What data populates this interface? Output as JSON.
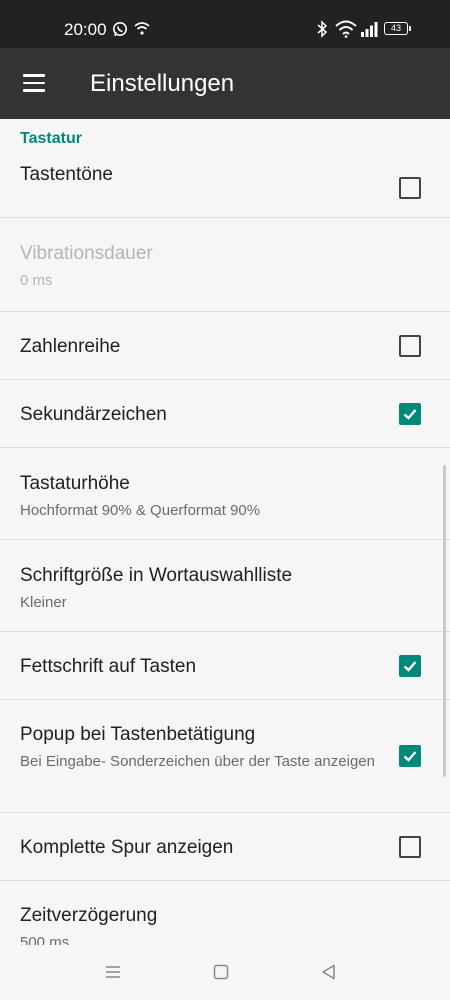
{
  "status_bar": {
    "time": "20:00",
    "battery": "43"
  },
  "app_bar": {
    "title": "Einstellungen"
  },
  "section": {
    "title": "Tastatur"
  },
  "prefs": [
    {
      "title": "Tastentöne",
      "checked": false
    },
    {
      "title": "Vibrationsdauer",
      "summary": "0 ms",
      "disabled": true
    },
    {
      "title": "Zahlenreihe",
      "checked": false
    },
    {
      "title": "Sekundärzeichen",
      "checked": true
    },
    {
      "title": "Tastaturhöhe",
      "summary": "Hochformat 90% & Querformat 90%"
    },
    {
      "title": "Schriftgröße in Wortauswahlliste",
      "summary": "Kleiner"
    },
    {
      "title": "Fettschrift auf Tasten",
      "checked": true
    },
    {
      "title": "Popup bei Tastenbetätigung",
      "summary": "Bei Eingabe- Sonderzeichen über der Taste anzeigen",
      "checked": true
    },
    {
      "title": "Komplette Spur anzeigen",
      "checked": false
    },
    {
      "title": "Zeitverzögerung",
      "summary": "500 ms"
    }
  ],
  "icons": {
    "menu": "hamburger-menu-icon",
    "checkbox_checked": "checkmark-icon",
    "nav_recent": "recent-apps-icon",
    "nav_home": "home-icon",
    "nav_back": "back-icon"
  },
  "colors": {
    "accent": "#00897b",
    "app_bar": "#333333",
    "status_bar": "#222222"
  }
}
